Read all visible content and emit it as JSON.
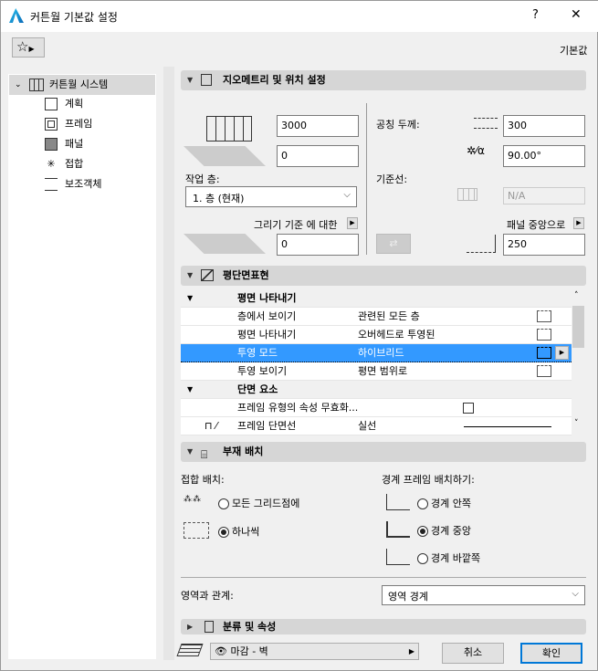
{
  "window": {
    "title": "커튼월 기본값 설정",
    "help": "?",
    "close": "✕",
    "defaults_label": "기본값"
  },
  "tree": {
    "root": "커튼월 시스템",
    "items": [
      {
        "label": "계획",
        "icon": "scheme-icon"
      },
      {
        "label": "프레임",
        "icon": "frame-icon"
      },
      {
        "label": "패널",
        "icon": "panel-icon"
      },
      {
        "label": "접합",
        "icon": "junction-icon"
      },
      {
        "label": "보조객체",
        "icon": "accessory-icon"
      }
    ]
  },
  "geometry": {
    "title": "지오메트리 및 위치 설정",
    "height": "3000",
    "offset": "0",
    "home_story_label": "작업 층:",
    "home_story": "1. 층 (현재)",
    "relative_label": "그리기 기준 에 대한",
    "relative_value": "0",
    "nominal_thickness_label": "공칭 두께:",
    "thickness": "300",
    "angle": "90.00°",
    "reference_line_label": "기준선:",
    "reference_value": "N/A",
    "panel_center_label": "패널 중앙으로",
    "panel_offset": "250"
  },
  "plan": {
    "title": "평단면표현",
    "rows": [
      {
        "type": "group",
        "label": "평면 나타내기"
      },
      {
        "type": "row",
        "label": "층에서 보이기",
        "value": "관련된 모든 층"
      },
      {
        "type": "row",
        "label": "평면 나타내기",
        "value": "오버헤드로 투영된"
      },
      {
        "type": "row",
        "label": "투영 모드",
        "value": "하이브리드",
        "selected": true
      },
      {
        "type": "row",
        "label": "투영 보이기",
        "value": "평면 범위로"
      },
      {
        "type": "group",
        "label": "단면 요소"
      },
      {
        "type": "check",
        "label": "프레임 유형의 속성 무효화...",
        "value": ""
      },
      {
        "type": "row",
        "label": "프레임 단면선",
        "value": "실선"
      }
    ]
  },
  "placement": {
    "title": "부재 배치",
    "junction_label": "접합 배치:",
    "junction_options": [
      {
        "label": "모든 그리드점에",
        "checked": false
      },
      {
        "label": "하나씩",
        "checked": true
      }
    ],
    "boundary_label": "경계 프레임 배치하기:",
    "boundary_options": [
      {
        "label": "경계 안쪽",
        "checked": false
      },
      {
        "label": "경계 중앙",
        "checked": true
      },
      {
        "label": "경계 바깥쪽",
        "checked": false
      }
    ],
    "zone_label": "영역과 관계:",
    "zone_value": "영역 경계"
  },
  "classification": {
    "title": "분류 및 속성"
  },
  "footer": {
    "layer": "마감 - 벽",
    "cancel": "취소",
    "ok": "확인"
  },
  "colors": {
    "selection": "#3399ff",
    "ok_border": "#0078d7"
  }
}
